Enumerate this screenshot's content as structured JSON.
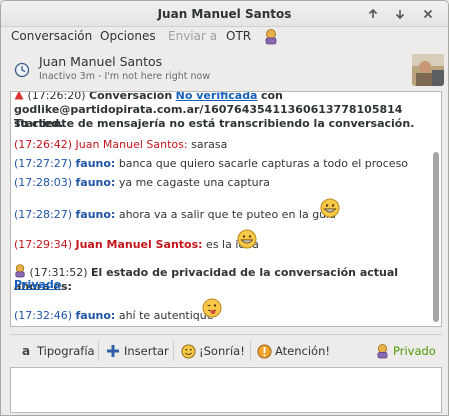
{
  "window": {
    "title": "Juan Manuel Santos"
  },
  "menu": {
    "items": [
      {
        "label": "Conversación",
        "enabled": true
      },
      {
        "label": "Opciones",
        "enabled": true
      },
      {
        "label": "Enviar a",
        "enabled": false
      },
      {
        "label": "OTR",
        "enabled": true
      }
    ]
  },
  "contact": {
    "name": "Juan Manuel Santos",
    "status": "Inactivo 3m - I'm not here right now"
  },
  "history": {
    "header_line1_ts": "(17:26:20)",
    "header_line1_text": "Conversación",
    "header_line1_link": "No verificada",
    "header_line1_tail": "con",
    "header_line2": "godlike@partidopirata.com.ar/1607643541136061377810581​4 started.",
    "header_line3": "Tu cliente de mensajería no está transcribiendo la conversación.",
    "messages": [
      {
        "ts": "(17:26:42)",
        "sender": "Juan Manuel Santos:",
        "text": "sarasa",
        "who": "me"
      },
      {
        "ts": "(17:27:27)",
        "sender": "fauno:",
        "text": "banca que quiero sacarle capturas a todo el proceso",
        "who": "them"
      },
      {
        "ts": "(17:28:03)",
        "sender": "fauno:",
        "text": "ya me cagaste una captura",
        "who": "them"
      },
      {
        "ts": "(17:28:27)",
        "sender": "fauno:",
        "text": "ahora va a salir que te puteo en la guía",
        "who": "them"
      },
      {
        "ts": "(17:29:34)",
        "sender": "Juan Manuel Santos:",
        "text": "es la idea",
        "who": "me"
      },
      {
        "ts": "(17:32:46)",
        "sender": "fauno:",
        "text": "ahí te autentiqué",
        "who": "them"
      }
    ],
    "privacy_ts": "(17:31:52)",
    "privacy_text": "El estado de privacidad de la conversación actual ahora es:",
    "privacy_link": "Privado"
  },
  "toolbar": {
    "font_label": "Tipografía",
    "insert_label": "Insertar",
    "smile_label": "¡Sonría!",
    "attention_label": "Atención!",
    "privacy_label": "Privado"
  },
  "colors": {
    "me": "#c4161c",
    "them": "#1f55a6",
    "private": "#4e9a06"
  },
  "icons": [
    "clock-icon",
    "smiley-grin-icon",
    "smiley-tongue-icon",
    "font-icon",
    "plus-icon",
    "smile-icon",
    "attention-icon",
    "pidgin-otr-icon"
  ]
}
